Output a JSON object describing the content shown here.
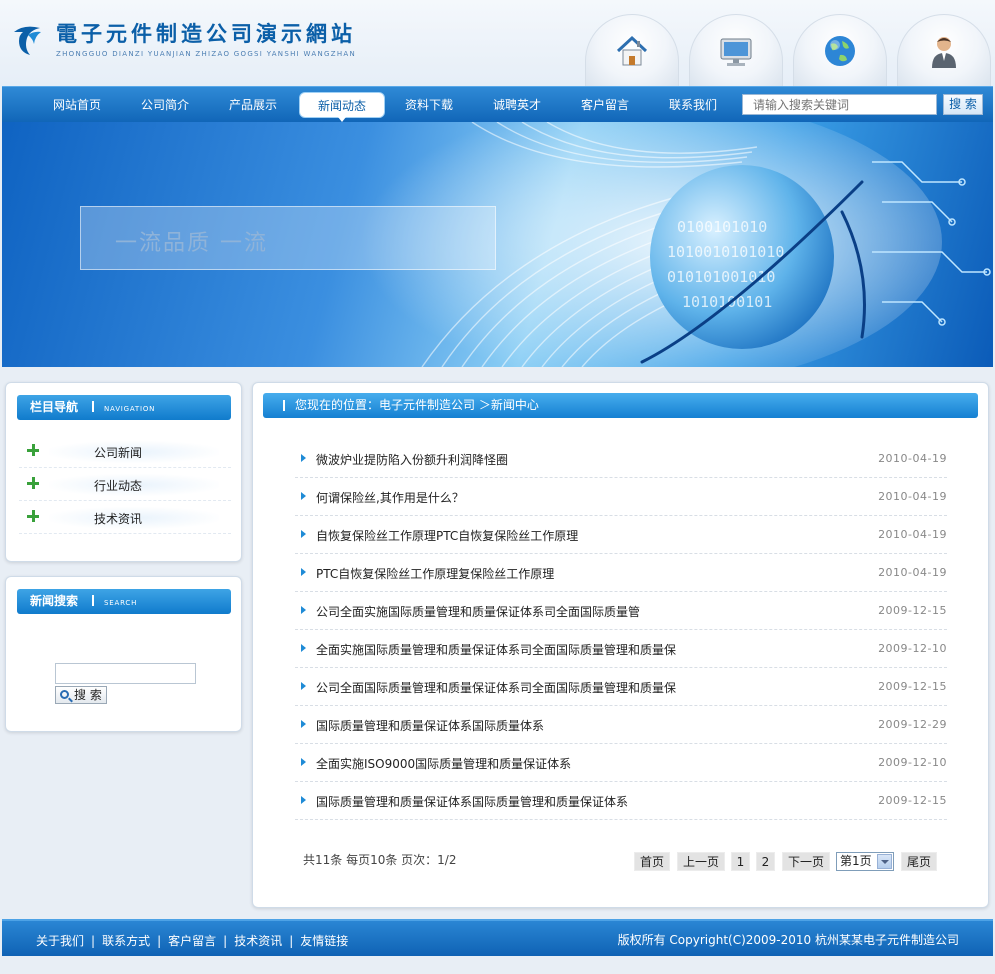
{
  "logo": {
    "cn": "電子元件制造公司演示網站",
    "en": "ZHONGGUO DIANZI YUANJIAN ZHIZAO GOGSI YANSHI WANGZHAN"
  },
  "top_icons": [
    "home-icon",
    "monitor-icon",
    "globe-icon",
    "user-icon"
  ],
  "nav": {
    "items": [
      "网站首页",
      "公司简介",
      "产品展示",
      "新闻动态",
      "资料下载",
      "诚聘英才",
      "客户留言",
      "联系我们"
    ],
    "active": "新闻动态",
    "search_placeholder": "请输入搜索关键词",
    "search_button": "搜 索"
  },
  "banner": {
    "slogan": "一流品质 一流"
  },
  "sidebar": {
    "nav_panel": {
      "title": "栏目导航",
      "title_en": "NAVIGATION",
      "items": [
        "公司新闻",
        "行业动态",
        "技术资讯"
      ]
    },
    "search_panel": {
      "title": "新闻搜索",
      "title_en": "SEARCH",
      "button": "搜 索"
    }
  },
  "main": {
    "breadcrumb": "您现在的位置：电子元件制造公司 ＞新闻中心",
    "news": [
      {
        "title": "微波炉业提防陷入份额升利润降怪圈",
        "date": "2010-04-19"
      },
      {
        "title": "何谓保险丝,其作用是什么？",
        "date": "2010-04-19"
      },
      {
        "title": "自恢复保险丝工作原理PTC自恢复保险丝工作原理",
        "date": "2010-04-19"
      },
      {
        "title": "PTC自恢复保险丝工作原理复保险丝工作原理",
        "date": "2010-04-19"
      },
      {
        "title": "公司全面实施国际质量管理和质量保证体系司全面国际质量管",
        "date": "2009-12-15"
      },
      {
        "title": "全面实施国际质量管理和质量保证体系司全面国际质量管理和质量保",
        "date": "2009-12-10"
      },
      {
        "title": "公司全面国际质量管理和质量保证体系司全面国际质量管理和质量保",
        "date": "2009-12-15"
      },
      {
        "title": "国际质量管理和质量保证体系国际质量体系",
        "date": "2009-12-29"
      },
      {
        "title": "全面实施ISO9000国际质量管理和质量保证体系",
        "date": "2009-12-10"
      },
      {
        "title": "国际质量管理和质量保证体系国际质量管理和质量保证体系",
        "date": "2009-12-15"
      }
    ],
    "pager": {
      "info": "共11条  每页10条  页次：1/2",
      "first": "首页",
      "prev": "上一页",
      "pages": [
        "1",
        "2"
      ],
      "next": "下一页",
      "select": "第1页",
      "last": "尾页"
    }
  },
  "footer": {
    "links": [
      "关于我们",
      "联系方式",
      "客户留言",
      "技术资讯",
      "友情链接"
    ],
    "separator": "|",
    "copyright": "版权所有  Copyright(C)2009-2010 杭州某某电子元件制造公司"
  },
  "colors": {
    "brand_blue": "#1166b8",
    "accent_blue": "#1f8bd6",
    "plus_green": "#39a13b"
  }
}
